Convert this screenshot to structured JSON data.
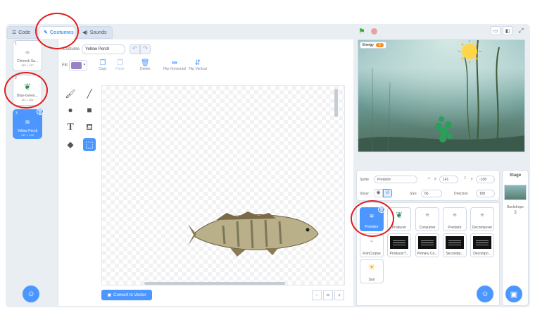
{
  "tabs": {
    "code": "Code",
    "costumes": "Costumes",
    "sounds": "Sounds"
  },
  "costumes": [
    {
      "num": "1",
      "name": "Chinook Sa...",
      "size": "187 × 117"
    },
    {
      "num": "2",
      "name": "Blue-Green...",
      "size": "111 × 202"
    },
    {
      "num": "3",
      "name": "Yellow Perch",
      "size": "157 × 132"
    }
  ],
  "editor": {
    "costume_label": "Costume",
    "costume_name": "Yellow Perch",
    "fill_label": "Fill",
    "fill_color": "#9a82c6",
    "copy": "Copy",
    "paste": "Paste",
    "delete": "Delete",
    "flip_h": "Flip Horizontal",
    "flip_v": "Flip Vertical",
    "convert": "Convert to Vector",
    "zoom_out": "-",
    "zoom_reset": "=",
    "zoom_in": "+"
  },
  "stage": {
    "monitor_label": "Energy",
    "monitor_value": "0"
  },
  "sprite_info": {
    "sprite_label": "Sprite",
    "sprite_name": "Predator",
    "x_label": "x",
    "x_value": "141",
    "y_label": "y",
    "y_value": "-108",
    "show_label": "Show",
    "size_label": "Size",
    "size_value": "66",
    "direction_label": "Direction",
    "direction_value": "180"
  },
  "sprites": [
    {
      "name": "Predator"
    },
    {
      "name": "Producer"
    },
    {
      "name": "Consumer"
    },
    {
      "name": "Predator"
    },
    {
      "name": "Decomposer"
    },
    {
      "name": "FishCorpse"
    },
    {
      "name": "ProducerT..."
    },
    {
      "name": "Primary Co..."
    },
    {
      "name": "Secondar..."
    },
    {
      "name": "Decompo..."
    },
    {
      "name": "Sun"
    }
  ],
  "stage_pane": {
    "title": "Stage",
    "backdrops_label": "Backdrops",
    "backdrops_count": "3"
  },
  "colors": {
    "accent": "#4c97ff",
    "annotation": "#e21d1d",
    "monitor": "#ff8c1a"
  },
  "icons": [
    "green-flag-icon",
    "stop-icon",
    "brush-icon",
    "line-icon",
    "circle-icon",
    "rect-icon",
    "text-icon",
    "fill-icon",
    "eraser-icon",
    "select-icon",
    "trash-icon",
    "cat-icon"
  ]
}
